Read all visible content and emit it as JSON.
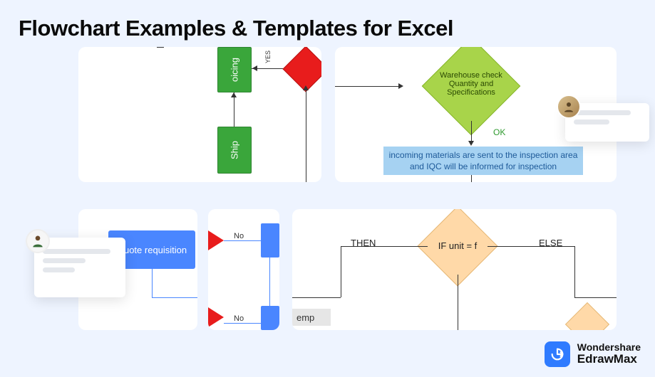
{
  "title": "Flowchart  Examples & Templates for Excel",
  "card1": {
    "box1": "oicing",
    "box2": "Ship",
    "yes": "YES"
  },
  "card2": {
    "diamond": "Warehouse check\nQuantity and\nSpecifications",
    "ok": "OK",
    "rect": "incoming materials are sent to the inspection area and IQC will be informed for inspection"
  },
  "card3": {
    "box": "Quote requisition"
  },
  "card4": {
    "no1": "No",
    "no2": "No"
  },
  "card5": {
    "then": "THEN",
    "else": "ELSE",
    "cond": "IF unit = f",
    "emp": "emp"
  },
  "brand": {
    "top": "Wondershare",
    "bot": "EdrawMax"
  }
}
